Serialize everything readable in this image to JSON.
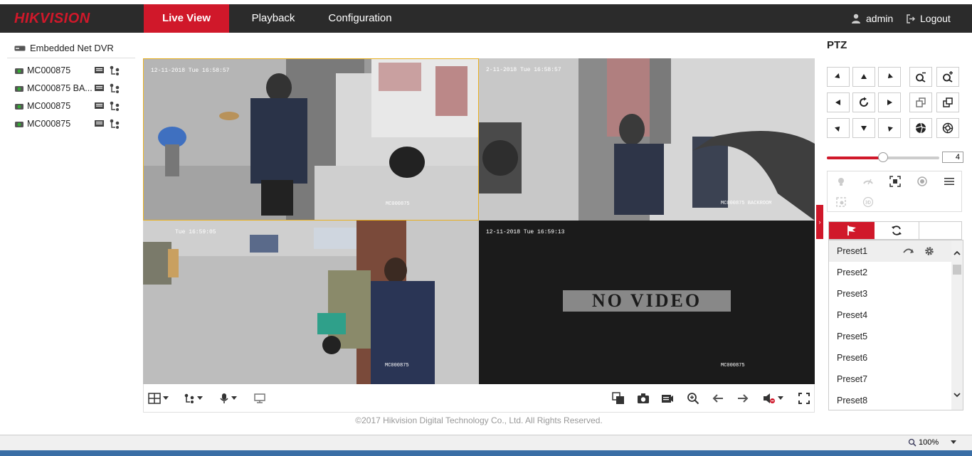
{
  "header": {
    "logo": "HIKVISION",
    "tabs": [
      {
        "label": "Live View",
        "active": true
      },
      {
        "label": "Playback",
        "active": false
      },
      {
        "label": "Configuration",
        "active": false
      }
    ],
    "user": "admin",
    "logout": "Logout"
  },
  "device_tree": {
    "root": "Embedded Net DVR",
    "cameras": [
      {
        "name": "MC000875"
      },
      {
        "name": "MC000875 BA..."
      },
      {
        "name": "MC000875"
      },
      {
        "name": "MC000875"
      }
    ]
  },
  "video": {
    "panes": [
      {
        "timestamp": "12-11-2018 Tue 16:58:57",
        "channel": "MC000875",
        "selected": true
      },
      {
        "timestamp": "2-11-2018 Tue 16:58:57",
        "channel": "MC000875 BACKROOM",
        "selected": false
      },
      {
        "timestamp": "Tue 16:59:05",
        "channel": "MC000875",
        "selected": false
      },
      {
        "timestamp": "12-11-2018 Tue 16:59:13",
        "channel": "MC000875",
        "selected": false,
        "no_video": "NO VIDEO"
      }
    ]
  },
  "footer": "©2017 Hikvision Digital Technology Co., Ltd. All Rights Reserved.",
  "ptz": {
    "title": "PTZ",
    "speed": "4",
    "speed_fraction": 0.5,
    "presets": [
      "Preset1",
      "Preset2",
      "Preset3",
      "Preset4",
      "Preset5",
      "Preset6",
      "Preset7",
      "Preset8"
    ]
  },
  "statusbar": {
    "zoom": "100%"
  },
  "colors": {
    "brand_red": "#d0182a",
    "header_bg": "#2b2b2b",
    "selected_border": "#e8b020"
  }
}
